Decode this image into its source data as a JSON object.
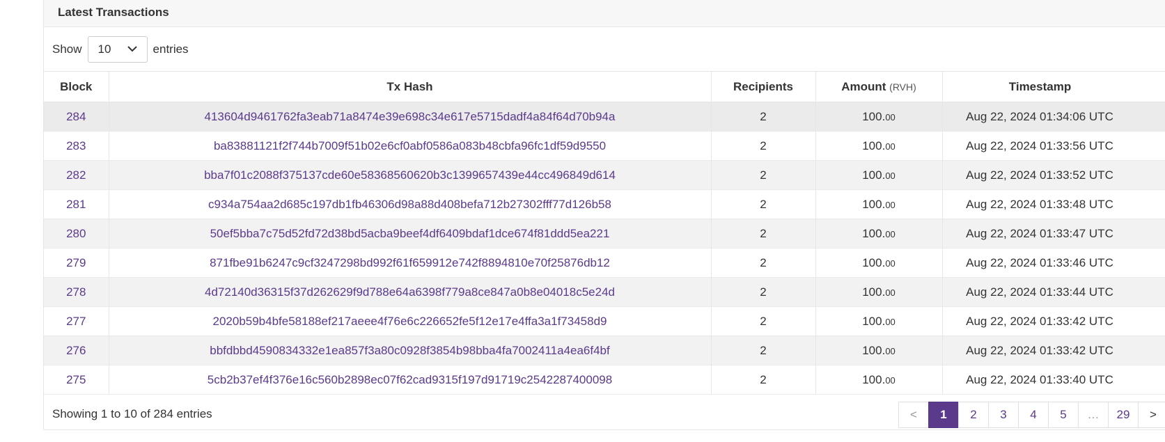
{
  "card": {
    "title": "Latest Transactions"
  },
  "length": {
    "show": "Show",
    "value": "10",
    "entries": "entries"
  },
  "columns": {
    "block": "Block",
    "hash": "Tx Hash",
    "recipients": "Recipients",
    "amount": "Amount",
    "amount_unit": "(RVH)",
    "timestamp": "Timestamp"
  },
  "rows": [
    {
      "block": "284",
      "hash": "413604d9461762fa3eab71a8474e39e698c34e617e5715dadf4a84f64d70b94a",
      "recipients": "2",
      "amount_int": "100.",
      "amount_dec": "00",
      "timestamp": "Aug 22, 2024 01:34:06 UTC"
    },
    {
      "block": "283",
      "hash": "ba83881121f2f744b7009f51b02e6cf0abf0586a083b48cbfa96fc1df59d9550",
      "recipients": "2",
      "amount_int": "100.",
      "amount_dec": "00",
      "timestamp": "Aug 22, 2024 01:33:56 UTC"
    },
    {
      "block": "282",
      "hash": "bba7f01c2088f375137cde60e58368560620b3c1399657439e44cc496849d614",
      "recipients": "2",
      "amount_int": "100.",
      "amount_dec": "00",
      "timestamp": "Aug 22, 2024 01:33:52 UTC"
    },
    {
      "block": "281",
      "hash": "c934a754aa2d685c197db1fb46306d98a88d408befa712b27302fff77d126b58",
      "recipients": "2",
      "amount_int": "100.",
      "amount_dec": "00",
      "timestamp": "Aug 22, 2024 01:33:48 UTC"
    },
    {
      "block": "280",
      "hash": "50ef5bba7c75d52fd72d38bd5acba9beef4df6409bdaf1dce674f81ddd5ea221",
      "recipients": "2",
      "amount_int": "100.",
      "amount_dec": "00",
      "timestamp": "Aug 22, 2024 01:33:47 UTC"
    },
    {
      "block": "279",
      "hash": "871fbe91b6247c9cf3247298bd992f61f659912e742f8894810e70f25876db12",
      "recipients": "2",
      "amount_int": "100.",
      "amount_dec": "00",
      "timestamp": "Aug 22, 2024 01:33:46 UTC"
    },
    {
      "block": "278",
      "hash": "4d72140d36315f37d262629f9d788e64a6398f779a8ce847a0b8e04018c5e24d",
      "recipients": "2",
      "amount_int": "100.",
      "amount_dec": "00",
      "timestamp": "Aug 22, 2024 01:33:44 UTC"
    },
    {
      "block": "277",
      "hash": "2020b59b4bfe58188ef217aeee4f76e6c226652fe5f12e17e4ffa3a1f73458d9",
      "recipients": "2",
      "amount_int": "100.",
      "amount_dec": "00",
      "timestamp": "Aug 22, 2024 01:33:42 UTC"
    },
    {
      "block": "276",
      "hash": "bbfdbbd4590834332e1ea857f3a80c0928f3854b98bba4fa7002411a4ea6f4bf",
      "recipients": "2",
      "amount_int": "100.",
      "amount_dec": "00",
      "timestamp": "Aug 22, 2024 01:33:42 UTC"
    },
    {
      "block": "275",
      "hash": "5cb2b37ef4f376e16c560b2898ec07f62cad9315f197d91719c2542287400098",
      "recipients": "2",
      "amount_int": "100.",
      "amount_dec": "00",
      "timestamp": "Aug 22, 2024 01:33:40 UTC"
    }
  ],
  "footer": {
    "info": "Showing 1 to 10 of 284 entries"
  },
  "pagination": {
    "prev": "<",
    "pages": [
      "1",
      "2",
      "3",
      "4",
      "5",
      "…",
      "29"
    ],
    "active": "1",
    "next": ">"
  },
  "colors": {
    "accent": "#5b3a8c"
  }
}
